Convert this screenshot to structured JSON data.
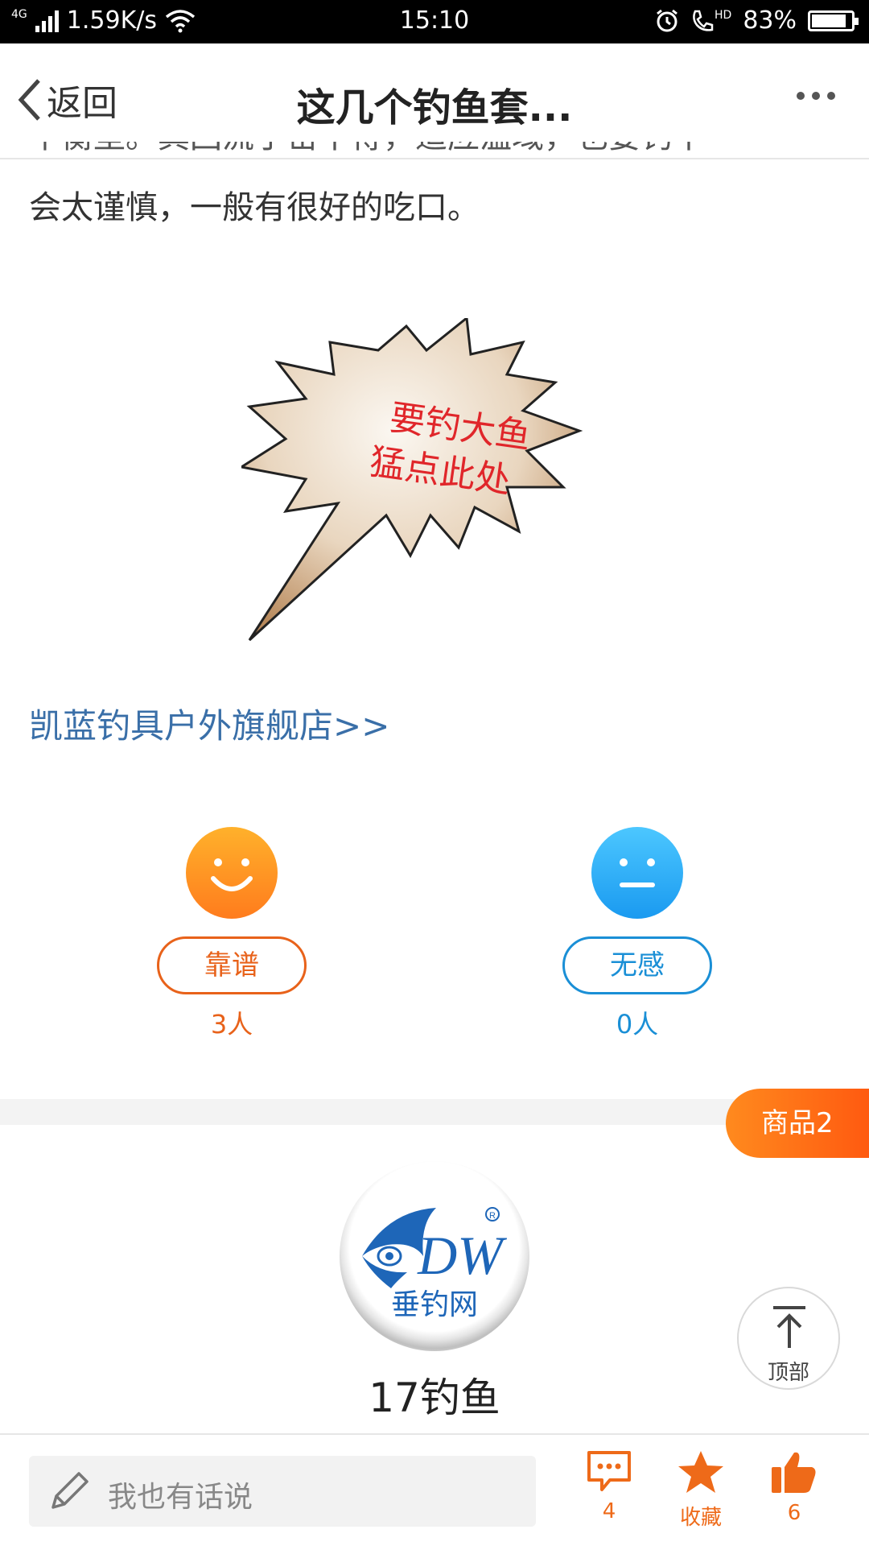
{
  "status_bar": {
    "network_type": "4G",
    "speed": "1.59K/s",
    "time": "15:10",
    "hd_label": "HD",
    "battery": "83%"
  },
  "header": {
    "back_label": "返回",
    "title": "这几个钓鱼套..."
  },
  "article": {
    "text_partial_top": "平衡型。其回流于密不得，适应温域，也要钓不",
    "text": "会太谨慎，一般有很好的吃口。",
    "banner_text_line1": "要钓大鱼",
    "banner_text_line2": "猛点此处",
    "shop_link": "凯蓝钓具户外旗舰店>>"
  },
  "votes": {
    "positive": {
      "label": "靠谱",
      "count": "3人"
    },
    "neutral": {
      "label": "无感",
      "count": "0人"
    }
  },
  "goods_badge": "商品2",
  "shop": {
    "logo_letters": "DW",
    "logo_text": "垂钓网",
    "name": "17钓鱼"
  },
  "to_top_label": "顶部",
  "bottom_bar": {
    "comment_placeholder": "我也有话说",
    "comment_count": "4",
    "favorite_label": "收藏",
    "like_count": "6"
  },
  "colors": {
    "accent_orange": "#ee6a19",
    "accent_blue": "#1a8fd6",
    "link_blue": "#3a6fa8"
  }
}
